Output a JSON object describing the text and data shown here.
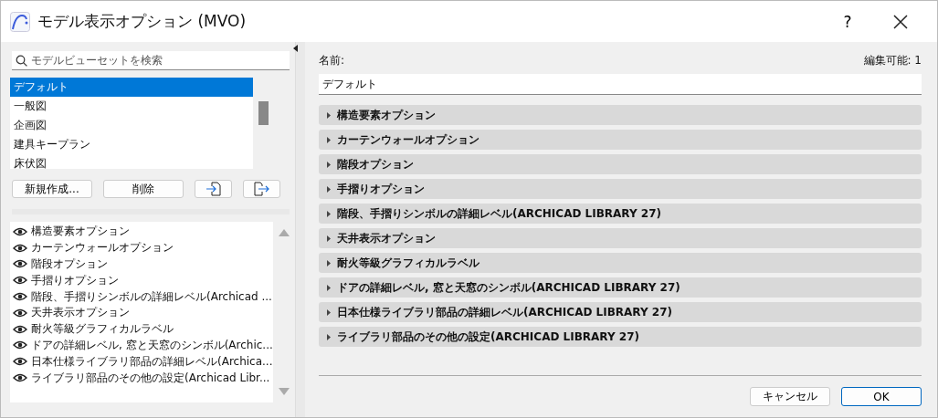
{
  "window": {
    "title": "モデル表示オプション (MVO)",
    "help": "?"
  },
  "search": {
    "placeholder": "モデルビューセットを検索"
  },
  "view_sets": [
    {
      "label": "デフォルト",
      "selected": true
    },
    {
      "label": "一般図",
      "selected": false
    },
    {
      "label": "企画図",
      "selected": false
    },
    {
      "label": "建具キープラン",
      "selected": false
    },
    {
      "label": "床伏図",
      "selected": false
    }
  ],
  "set_buttons": [
    "新規作成...",
    "削除"
  ],
  "option_list": [
    {
      "label": "構造要素オプション",
      "visible": true
    },
    {
      "label": "カーテンウォールオプション",
      "visible": true
    },
    {
      "label": "階段オプション",
      "visible": true
    },
    {
      "label": "手摺りオプション",
      "visible": true
    },
    {
      "label": "階段、手摺りシンボルの詳細レベル(Archicad ...",
      "visible": true
    },
    {
      "label": "天井表示オプション",
      "visible": true
    },
    {
      "label": "耐火等級グラフィカルラベル",
      "visible": true
    },
    {
      "label": "ドアの詳細レベル, 窓と天窓のシンボル(Archic...",
      "visible": true
    },
    {
      "label": "日本仕様ライブラリ部品の詳細レベル(Archica...",
      "visible": true
    },
    {
      "label": "ライブラリ部品のその他の設定(Archicad Libr...",
      "visible": true
    }
  ],
  "name_label": "名前:",
  "editable": "編集可能: 1",
  "name_value": "デフォルト",
  "sections": [
    {
      "label": "構造要素オプション",
      "expanded": false
    },
    {
      "label": "カーテンウォールオプション",
      "expanded": false
    },
    {
      "label": "階段オプション",
      "expanded": false
    },
    {
      "label": "手摺りオプション",
      "expanded": false
    },
    {
      "label": "階段、手摺りシンボルの詳細レベル(ARCHICAD LIBRARY 27)",
      "expanded": false
    },
    {
      "label": "天井表示オプション",
      "expanded": false
    },
    {
      "label": "耐火等級グラフィカルラベル",
      "expanded": false
    },
    {
      "label": "ドアの詳細レベル, 窓と天窓のシンボル(ARCHICAD LIBRARY 27)",
      "expanded": false
    },
    {
      "label": "日本仕様ライブラリ部品の詳細レベル(ARCHICAD LIBRARY 27)",
      "expanded": false
    },
    {
      "label": "ライブラリ部品のその他の設定(ARCHICAD LIBRARY 27)",
      "expanded": false
    }
  ],
  "footer_buttons": [
    {
      "label": "キャンセル",
      "kind": "normal"
    },
    {
      "label": "OK",
      "kind": "default"
    }
  ]
}
